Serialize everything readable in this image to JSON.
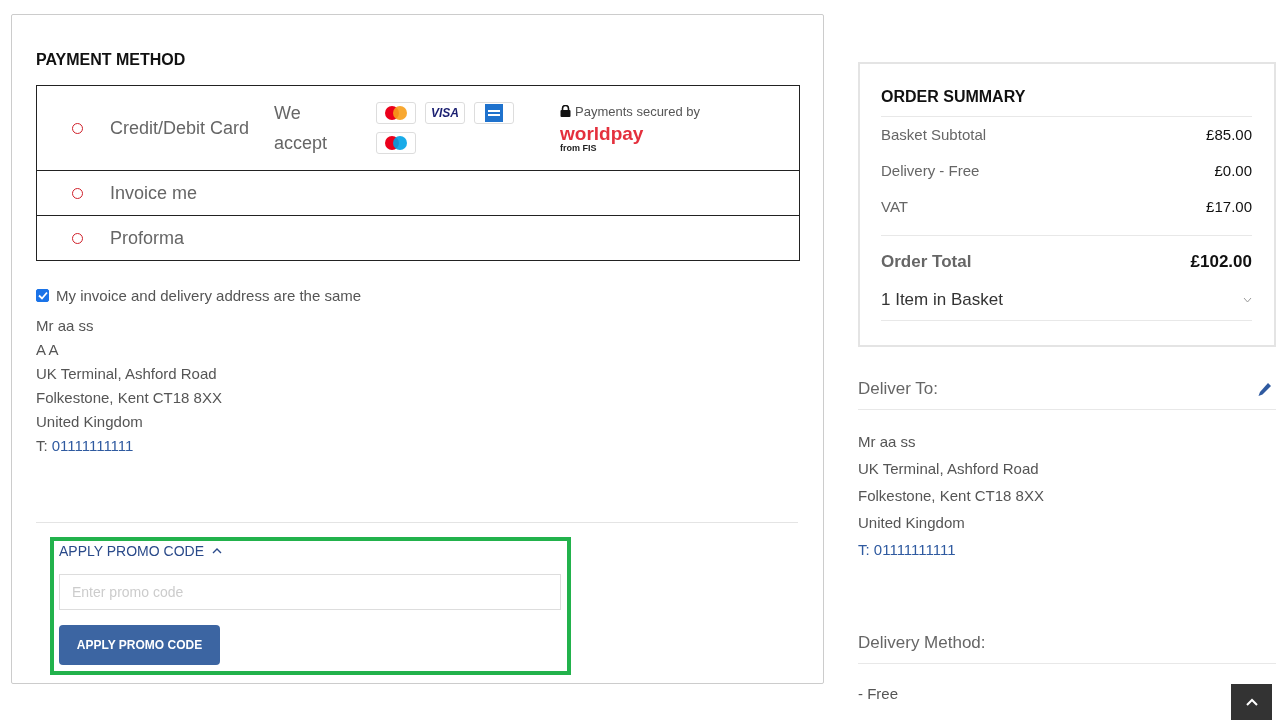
{
  "payment_method": {
    "title": "PAYMENT METHOD",
    "options": [
      {
        "kind": "card",
        "label": "Credit/Debit Card",
        "selected": false,
        "accept_label": "We accept",
        "cards": [
          {
            "kind": "mastercard"
          },
          {
            "kind": "visa",
            "label": "VISA"
          },
          {
            "kind": "amex"
          },
          {
            "kind": "maestro"
          }
        ],
        "secured_label": "Payments secured by",
        "provider": "worldpay",
        "provider_sub": "from FIS"
      },
      {
        "kind": "plain",
        "label": "Invoice me",
        "selected": false
      },
      {
        "kind": "plain",
        "label": "Proforma",
        "selected": false
      }
    ]
  },
  "same_address": {
    "label": "My invoice and delivery address are the same",
    "checked": true
  },
  "invoice_address": {
    "lines": [
      "Mr aa ss",
      "A A",
      "UK Terminal, Ashford Road",
      "Folkestone, Kent CT18 8XX",
      "United Kingdom"
    ],
    "phone_prefix": "T:",
    "phone": "01111111111"
  },
  "promo": {
    "toggle": "APPLY PROMO CODE",
    "expanded": true,
    "placeholder": "Enter promo code",
    "button": "APPLY PROMO CODE"
  },
  "order_summary": {
    "title": "ORDER SUMMARY",
    "rows": [
      {
        "label": "Basket Subtotal",
        "value": "£85.00"
      },
      {
        "label": "Delivery - Free",
        "value": "£0.00"
      },
      {
        "label": "VAT",
        "value": "£17.00"
      }
    ],
    "total": {
      "label": "Order Total",
      "value": "£102.00"
    },
    "basket": {
      "label": "1 Item in Basket",
      "expanded": false
    }
  },
  "deliver_to": {
    "title": "Deliver To:",
    "lines": [
      "Mr aa ss",
      "UK Terminal, Ashford Road",
      "Folkestone, Kent CT18 8XX",
      "United Kingdom"
    ],
    "phone": "T: 01111111111"
  },
  "delivery_method": {
    "title": "Delivery Method:",
    "value": "- Free"
  }
}
